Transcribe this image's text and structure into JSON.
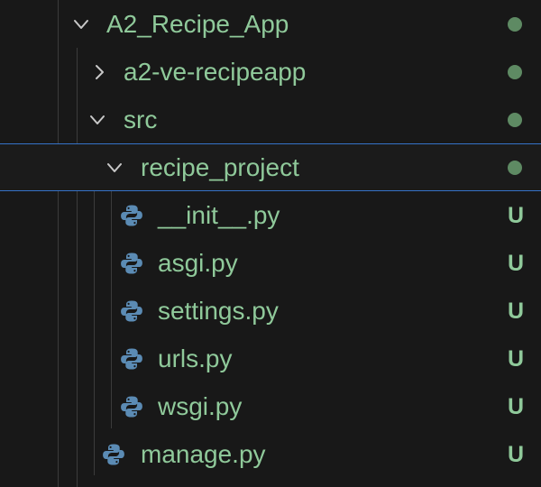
{
  "explorer": {
    "tree": [
      {
        "label": "A2_Recipe_App",
        "kind": "folder",
        "expanded": true,
        "decoration": "dot",
        "icon": "chevron-down-icon"
      },
      {
        "label": "a2-ve-recipeapp",
        "kind": "folder",
        "expanded": false,
        "decoration": "dot",
        "icon": "chevron-right-icon"
      },
      {
        "label": "src",
        "kind": "folder",
        "expanded": true,
        "decoration": "dot",
        "icon": "chevron-down-icon"
      },
      {
        "label": "recipe_project",
        "kind": "folder",
        "expanded": true,
        "decoration": "dot",
        "icon": "chevron-down-icon",
        "focused": true
      },
      {
        "label": "__init__.py",
        "kind": "file",
        "status": "U",
        "icon": "python-icon"
      },
      {
        "label": "asgi.py",
        "kind": "file",
        "status": "U",
        "icon": "python-icon"
      },
      {
        "label": "settings.py",
        "kind": "file",
        "status": "U",
        "icon": "python-icon"
      },
      {
        "label": "urls.py",
        "kind": "file",
        "status": "U",
        "icon": "python-icon"
      },
      {
        "label": "wsgi.py",
        "kind": "file",
        "status": "U",
        "icon": "python-icon"
      },
      {
        "label": "manage.py",
        "kind": "file",
        "status": "U",
        "icon": "python-icon"
      }
    ]
  },
  "colors": {
    "background": "#181818",
    "untracked_text": "#8fc99a",
    "folder_dot": "#5e8a63",
    "focus_border": "#3572c8",
    "indent_guide": "#3b3b3b",
    "python_blue": "#5b8bb4"
  }
}
